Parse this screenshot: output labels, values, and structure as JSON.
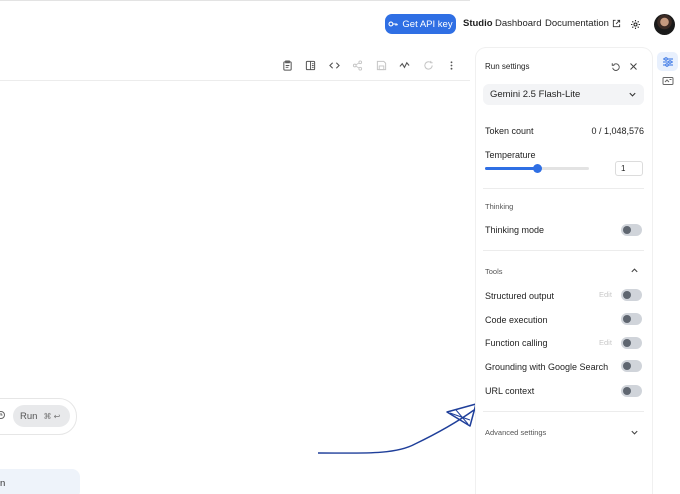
{
  "header": {
    "api_key_label": "Get API key",
    "studio_label": "Studio",
    "dashboard_label": "Dashboard",
    "documentation_label": "Documentation"
  },
  "toolbar": {
    "icons": [
      "clipboard-icon",
      "compare-icon",
      "code-icon",
      "share-icon",
      "save-icon",
      "branch-icon",
      "refresh-icon",
      "more-icon"
    ]
  },
  "prompt": {
    "run_label": "Run",
    "run_shortcut": "⌘ ↩",
    "message_partial": "n"
  },
  "run_settings": {
    "title": "Run settings",
    "model": "Gemini 2.5 Flash-Lite",
    "token_count_label": "Token count",
    "token_count_value": "0 / 1,048,576",
    "temperature_label": "Temperature",
    "temperature_value": "1",
    "temperature_fraction": 0.5,
    "thinking_section": "Thinking",
    "thinking_mode_label": "Thinking mode",
    "tools_section": "Tools",
    "structured_output_label": "Structured output",
    "code_execution_label": "Code execution",
    "function_calling_label": "Function calling",
    "grounding_label": "Grounding with Google Search",
    "url_context_label": "URL context",
    "edit_label": "Edit",
    "advanced_label": "Advanced settings"
  },
  "colors": {
    "accent": "#2f6fe4",
    "annotation_ink": "#1f3f9a"
  }
}
